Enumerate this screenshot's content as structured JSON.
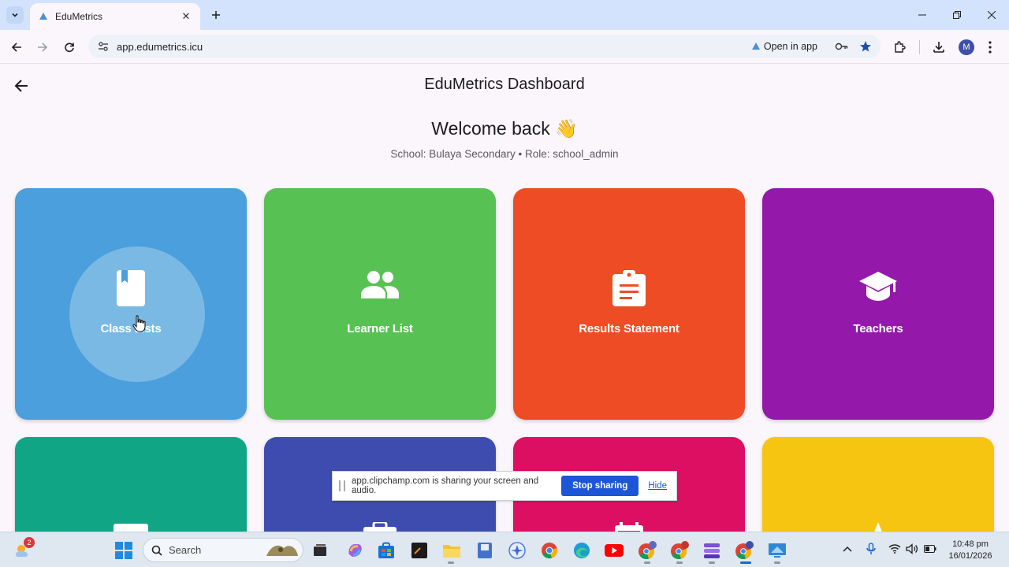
{
  "browser": {
    "tab_title": "EduMetrics",
    "url": "app.edumetrics.icu",
    "open_in_app": "Open in app",
    "profile_initial": "M"
  },
  "app": {
    "title": "EduMetrics Dashboard",
    "welcome": "Welcome back 👋",
    "subtitle": "School: Bulaya Secondary • Role: school_admin"
  },
  "tiles": [
    {
      "label": "Class Lists",
      "color": "#4a9fdc",
      "icon": "book-icon"
    },
    {
      "label": "Learner List",
      "color": "#58c153",
      "icon": "group-icon"
    },
    {
      "label": "Results Statement",
      "color": "#ee4c25",
      "icon": "clipboard-icon"
    },
    {
      "label": "Teachers",
      "color": "#9419ab",
      "icon": "graduation-cap-icon"
    },
    {
      "label": "",
      "color": "#10a584",
      "icon": "tile-5-icon"
    },
    {
      "label": "",
      "color": "#3f4caf",
      "icon": "briefcase-icon"
    },
    {
      "label": "",
      "color": "#dd0f63",
      "icon": "calendar-icon"
    },
    {
      "label": "",
      "color": "#f5c512",
      "icon": "tile-8-icon"
    }
  ],
  "share_bar": {
    "message": "app.clipchamp.com is sharing your screen and audio.",
    "stop_label": "Stop sharing",
    "hide_label": "Hide"
  },
  "taskbar": {
    "weather_badge": "2",
    "search_placeholder": "Search",
    "time": "10:48 pm",
    "date": "16/01/2026"
  }
}
